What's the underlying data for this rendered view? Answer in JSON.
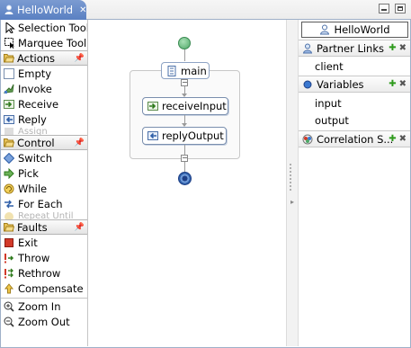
{
  "editor": {
    "tab_title": "HelloWorld"
  },
  "palette": {
    "tools": [
      {
        "label": "Selection Tool",
        "icon": "arrow-cursor-icon"
      },
      {
        "label": "Marquee Tool",
        "icon": "marquee-icon"
      }
    ],
    "actions": {
      "title": "Actions",
      "items": [
        "Empty",
        "Invoke",
        "Receive",
        "Reply",
        "Assign"
      ]
    },
    "control": {
      "title": "Control",
      "items": [
        "Switch",
        "Pick",
        "While",
        "For Each",
        "Repeat Until"
      ]
    },
    "faults": {
      "title": "Faults",
      "items": [
        "Exit",
        "Throw",
        "Rethrow",
        "Compensate"
      ]
    },
    "zoom": {
      "items": [
        "Zoom In",
        "Zoom Out"
      ]
    }
  },
  "canvas": {
    "sequence_label": "main",
    "activities": [
      "receiveInput",
      "replyOutput"
    ]
  },
  "outline": {
    "process_name": "HelloWorld",
    "partner_links": {
      "title": "Partner Links",
      "items": [
        "client"
      ]
    },
    "variables": {
      "title": "Variables",
      "items": [
        "input",
        "output"
      ]
    },
    "correlation_sets": {
      "title": "Correlation S..."
    }
  },
  "colors": {
    "tab_active": "#5a80c2",
    "start_node": "#5fb57a",
    "end_node": "#2f5fa8",
    "add_green": "#2e9a1c"
  }
}
